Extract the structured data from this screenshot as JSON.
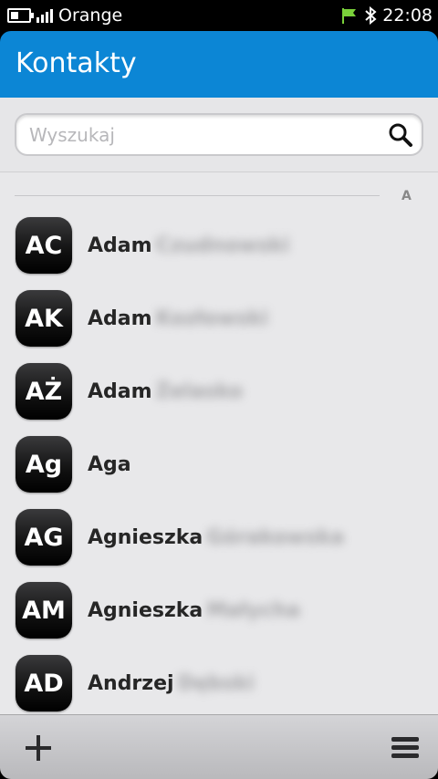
{
  "statusbar": {
    "carrier": "Orange",
    "time": "22:08",
    "battery_level": 0.4,
    "signal_bars": 4
  },
  "header": {
    "title": "Kontakty",
    "color": "#0c86d5"
  },
  "search": {
    "placeholder": "Wyszukaj",
    "icon": "search-icon"
  },
  "section": {
    "letter": "A"
  },
  "contacts": [
    {
      "initials": "AC",
      "first_name": "Adam",
      "surname": "Czudnowski"
    },
    {
      "initials": "AK",
      "first_name": "Adam",
      "surname": "Kozłowski"
    },
    {
      "initials": "AŻ",
      "first_name": "Adam",
      "surname": "Żelasko"
    },
    {
      "initials": "Ag",
      "first_name": "Aga",
      "surname": ""
    },
    {
      "initials": "AG",
      "first_name": "Agnieszka",
      "surname": "Górakowska"
    },
    {
      "initials": "AM",
      "first_name": "Agnieszka",
      "surname": "Małycha"
    },
    {
      "initials": "AD",
      "first_name": "Andrzej",
      "surname": "Dębski"
    }
  ],
  "toolbar": {
    "add_icon": "plus-icon",
    "menu_icon": "menu-icon"
  }
}
